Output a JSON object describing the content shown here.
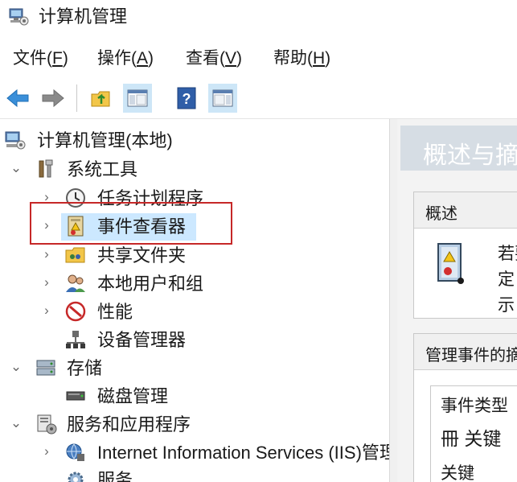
{
  "window": {
    "title": "计算机管理"
  },
  "menu": {
    "file": {
      "label": "文件",
      "accel": "(F)",
      "accel_u": "F"
    },
    "action": {
      "label": "操作",
      "accel": "(A)",
      "accel_u": "A"
    },
    "view": {
      "label": "查看",
      "accel": "(V)",
      "accel_u": "V"
    },
    "help": {
      "label": "帮助",
      "accel": "(H)",
      "accel_u": "H"
    }
  },
  "toolbar": {
    "buttons": [
      "back-arrow-icon",
      "forward-arrow-icon",
      "up-folder-icon",
      "show-hide-console-tree-icon",
      "help-icon",
      "show-hide-action-pane-icon"
    ],
    "active_color": "#cde6f7"
  },
  "tree": {
    "root": "计算机管理(本地)",
    "system_tools": "系统工具",
    "task_scheduler": "任务计划程序",
    "event_viewer": "事件查看器",
    "shared_folders": "共享文件夹",
    "local_users_groups": "本地用户和组",
    "performance": "性能",
    "device_manager": "设备管理器",
    "storage": "存储",
    "disk_management": "磁盘管理",
    "services_apps": "服务和应用程序",
    "iis": "Internet Information Services (IIS)管理器",
    "services": "服务"
  },
  "right_pane": {
    "header": "概述与摘要",
    "overview_title": "概述",
    "overview_line1": "若要",
    "overview_line2": "定",
    "overview_line3": "示",
    "manage_events_title": "管理事件的摘要",
    "event_type_col": "事件类型",
    "row1": "冊 关键",
    "row2": "关键"
  },
  "colors": {
    "selection": "#cce8ff",
    "highlight_box": "#c62828",
    "right_header_bg": "#d6dde4"
  }
}
